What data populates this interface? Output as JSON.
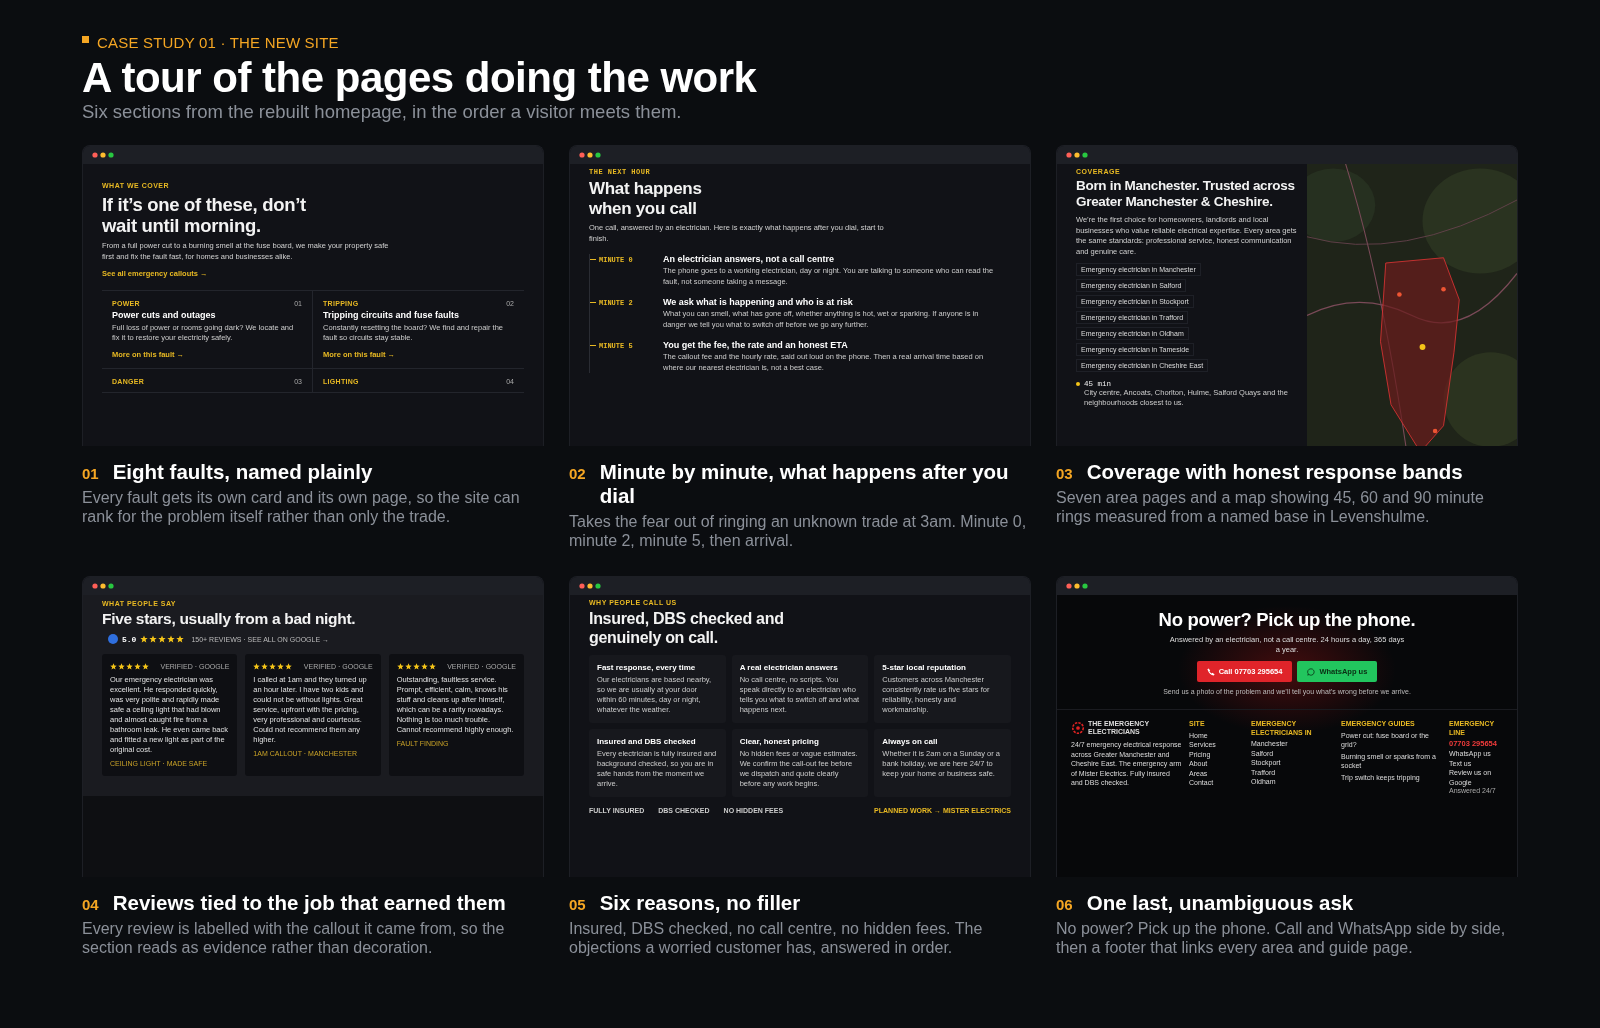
{
  "header": {
    "eyebrow": "CASE STUDY 01 · THE NEW SITE",
    "title": "A tour of the pages doing the work",
    "subtitle": "Six sections from the rebuilt homepage, in the order a visitor meets them."
  },
  "sections": [
    {
      "kind": "faults",
      "number": "01",
      "title": "Eight faults, named plainly",
      "description": "Every fault gets its own card and its own page, so the site can rank for the problem itself rather than only the trade.",
      "preview": {
        "eyebrow": "WHAT WE COVER",
        "heading": "If it’s one of these, don’t wait until morning.",
        "body": "From a full power cut to a burning smell at the fuse board, we make your property safe first and fix the fault fast, for homes and businesses alike.",
        "link": "See all emergency callouts →",
        "cards": [
          {
            "tag": "POWER",
            "number": "01",
            "title": "Power cuts and outages",
            "body": "Full loss of power or rooms going dark? We locate and fix it to restore your electricity safely.",
            "link": "More on this fault →"
          },
          {
            "tag": "TRIPPING",
            "number": "02",
            "title": "Tripping circuits and fuse faults",
            "body": "Constantly resetting the board? We find and repair the fault so circuits stay stable.",
            "link": "More on this fault →"
          },
          {
            "tag": "DANGER",
            "number": "03"
          },
          {
            "tag": "LIGHTING",
            "number": "04"
          }
        ]
      }
    },
    {
      "kind": "timeline",
      "number": "02",
      "title": "Minute by minute, what happens after you dial",
      "description": "Takes the fear out of ringing an unknown trade at 3am. Minute 0, minute 2, minute 5, then arrival.",
      "preview": {
        "eyebrow": "THE NEXT HOUR",
        "heading": "What happens when you call",
        "body": "One call, answered by an electrician. Here is exactly what happens after you dial, start to finish.",
        "steps": [
          {
            "label": "MINUTE 0",
            "title": "An electrician answers, not a call centre",
            "body": "The phone goes to a working electrician, day or night. You are talking to someone who can read the fault, not someone taking a message."
          },
          {
            "label": "MINUTE 2",
            "title": "We ask what is happening and who is at risk",
            "body": "What you can smell, what has gone off, whether anything is hot, wet or sparking. If anyone is in danger we tell you what to switch off before we go any further."
          },
          {
            "label": "MINUTE 5",
            "title": "You get the fee, the rate and an honest ETA",
            "body": "The callout fee and the hourly rate, said out loud on the phone. Then a real arrival time based on where our nearest electrician is, not a best case."
          }
        ]
      }
    },
    {
      "kind": "coverage",
      "number": "03",
      "title": "Coverage with honest response bands",
      "description": "Seven area pages and a map showing 45, 60 and 90 minute rings measured from a named base in Levenshulme.",
      "preview": {
        "eyebrow": "COVERAGE",
        "heading": "Born in Manchester. Trusted across Greater Manchester & Cheshire.",
        "body": "We’re the first choice for homeowners, landlords and local businesses who value reliable electrical expertise. Every area gets the same standards: professional service, honest communication and genuine care.",
        "areas": [
          "Emergency electrician in Manchester",
          "Emergency electrician in Salford",
          "Emergency electrician in Stockport",
          "Emergency electrician in Trafford",
          "Emergency electrician in Oldham",
          "Emergency electrician in Tameside",
          "Emergency electrician in Cheshire East"
        ],
        "band": {
          "time": "45 min",
          "areas": "City centre, Ancoats, Chorlton, Hulme, Salford Quays and the neighbourhoods closest to us."
        }
      }
    },
    {
      "kind": "reviews",
      "number": "04",
      "title": "Reviews tied to the job that earned them",
      "description": "Every review is labelled with the callout it came from, so the section reads as evidence rather than decoration.",
      "preview": {
        "eyebrow": "WHAT PEOPLE SAY",
        "heading": "Five stars, usually from a bad night.",
        "rating": {
          "score": "5.0",
          "stars": 5,
          "link": "150+ REVIEWS · SEE ALL ON GOOGLE →"
        },
        "reviews": [
          {
            "stars": 5,
            "source": "VERIFIED · GOOGLE",
            "text": "Our emergency electrician was excellent. He responded quickly, was very polite and rapidly made safe a ceiling light that had blown and almost caught fire from a bathroom leak. He even came back and fitted a new light as part of the original cost.",
            "tag": "CEILING LIGHT · MADE SAFE"
          },
          {
            "stars": 5,
            "source": "VERIFIED · GOOGLE",
            "text": "I called at 1am and they turned up an hour later. I have two kids and could not be without lights. Great service, upfront with the pricing, very professional and courteous. Could not recommend them any higher.",
            "tag": "1AM CALLOUT · MANCHESTER"
          },
          {
            "stars": 5,
            "source": "VERIFIED · GOOGLE",
            "text": "Outstanding, faultless service. Prompt, efficient, calm, knows his stuff and cleans up after himself, which can be a rarity nowadays. Nothing is too much trouble. Cannot recommend highly enough.",
            "tag": "FAULT FINDING"
          }
        ]
      }
    },
    {
      "kind": "reasons",
      "number": "05",
      "title": "Six reasons, no filler",
      "description": "Insured, DBS checked, no call centre, no hidden fees. The objections a worried customer has, answered in order.",
      "preview": {
        "eyebrow": "WHY PEOPLE CALL US",
        "heading": "Insured, DBS checked and genuinely on call.",
        "reasons": [
          {
            "title": "Fast response, every time",
            "body": "Our electricians are based nearby, so we are usually at your door within 60 minutes, day or night, whatever the weather."
          },
          {
            "title": "A real electrician answers",
            "body": "No call centre, no scripts. You speak directly to an electrician who tells you what to switch off and what happens next."
          },
          {
            "title": "5-star local reputation",
            "body": "Customers across Manchester consistently rate us five stars for reliability, honesty and workmanship."
          },
          {
            "title": "Insured and DBS checked",
            "body": "Every electrician is fully insured and background checked, so you are in safe hands from the moment we arrive."
          },
          {
            "title": "Clear, honest pricing",
            "body": "No hidden fees or vague estimates. We confirm the call-out fee before we dispatch and quote clearly before any work begins."
          },
          {
            "title": "Always on call",
            "body": "Whether it is 2am on a Sunday or a bank holiday, we are here 24/7 to keep your home or business safe."
          }
        ],
        "badges": [
          "FULLY INSURED",
          "DBS CHECKED",
          "NO HIDDEN FEES"
        ],
        "link": "PLANNED WORK → MISTER ELECTRICS"
      }
    },
    {
      "kind": "cta",
      "number": "06",
      "title": "One last, unambiguous ask",
      "description": "No power? Pick up the phone. Call and WhatsApp side by side, then a footer that links every area and guide page.",
      "preview": {
        "heading": "No power? Pick up the phone.",
        "body": "Answered by an electrician, not a call centre. 24 hours a day, 365 days a year.",
        "buttons": [
          {
            "kind": "call",
            "label": "Call 07703 295654"
          },
          {
            "kind": "whatsapp",
            "label": "WhatsApp us"
          }
        ],
        "note": "Send us a photo of the problem and we’ll tell you what’s wrong before we arrive.",
        "footer": {
          "logo": "THE EMERGENCY ELECTRICIANS",
          "about": "24/7 emergency electrical response across Greater Manchester and Cheshire East. The emergency arm of Mister Electrics. Fully insured and DBS checked.",
          "columns": [
            {
              "heading": "SITE",
              "links": [
                "Home",
                "Services",
                "Pricing",
                "About",
                "Areas",
                "Contact"
              ]
            },
            {
              "heading": "EMERGENCY ELECTRICIANS IN",
              "links": [
                "Manchester",
                "Salford",
                "Stockport",
                "Trafford",
                "Oldham"
              ]
            },
            {
              "heading": "EMERGENCY GUIDES",
              "links": [
                "Power cut: fuse board or the grid?",
                "Burning smell or sparks from a socket",
                "Trip switch keeps tripping"
              ]
            },
            {
              "heading": "EMERGENCY LINE",
              "phone": "07703 295654",
              "links": [
                "WhatsApp us",
                "Text us",
                "Review us on Google"
              ],
              "note": "Answered 24/7"
            }
          ]
        }
      }
    }
  ]
}
